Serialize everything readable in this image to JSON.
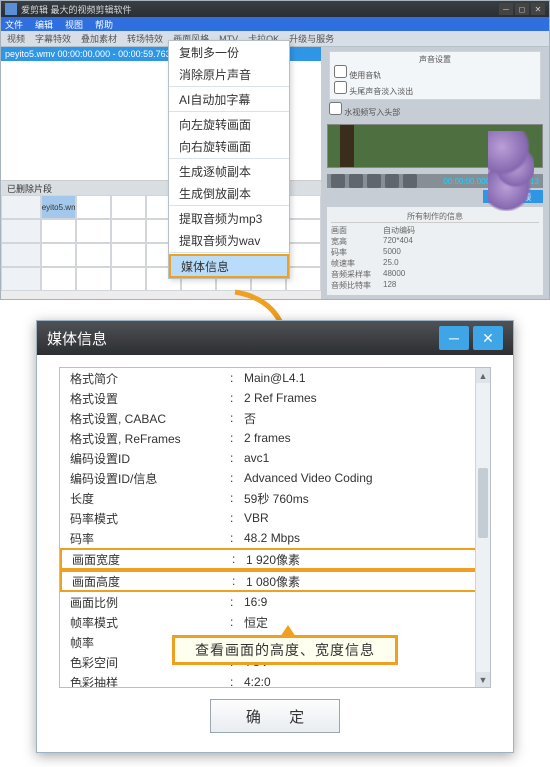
{
  "app": {
    "title": "爱剪辑 最大的视频剪辑软件",
    "menus": [
      "文件",
      "编辑",
      "视图",
      "帮助"
    ],
    "tabs": [
      "视频",
      "字幕特效",
      "叠加素材",
      "转场特效",
      "画面风格",
      "MTV",
      "卡拉OK",
      "升级与服务"
    ],
    "source_row": "peyito5.wmv   00:00:00.000 - 00:00:59.763   00:00:59.763",
    "timeline_col0": "已删除片段",
    "clip_name": "peyito5.wmv"
  },
  "preview": {
    "timecode": "00:00:00.000  00:00:05.713",
    "export_label": "导出视频",
    "panel_title": "所有制作的信息",
    "panel_rows": [
      {
        "k": "画面",
        "v": "自动编码"
      },
      {
        "k": "宽高",
        "v": "720*404"
      },
      {
        "k": "码率",
        "v": "5000"
      },
      {
        "k": "帧速率",
        "v": "25.0"
      },
      {
        "k": "音频采样率",
        "v": "48000"
      },
      {
        "k": "音频比特率",
        "v": "128"
      }
    ],
    "opt1": "声音设置",
    "chk1": "使用音轨",
    "chk2": "头尾声音淡入淡出",
    "chk3": "水视频写入头部"
  },
  "context_menu": {
    "items": [
      "复制多一份",
      "消除原片声音",
      "-",
      "AI自动加字幕",
      "-",
      "向左旋转画面",
      "向右旋转画面",
      "-",
      "生成逐帧副本",
      "生成倒放副本",
      "-",
      "提取音频为mp3",
      "提取音频为wav",
      "-",
      "媒体信息"
    ],
    "selected": "媒体信息"
  },
  "dialog": {
    "title": "媒体信息",
    "rows": [
      {
        "k": "格式简介",
        "v": "Main@L4.1"
      },
      {
        "k": "格式设置",
        "v": "2 Ref Frames"
      },
      {
        "k": "格式设置, CABAC",
        "v": "否"
      },
      {
        "k": "格式设置, ReFrames",
        "v": "2 frames"
      },
      {
        "k": "编码设置ID",
        "v": "avc1"
      },
      {
        "k": "编码设置ID/信息",
        "v": "Advanced Video Coding"
      },
      {
        "k": "长度",
        "v": "59秒 760ms"
      },
      {
        "k": "码率模式",
        "v": "VBR"
      },
      {
        "k": "码率",
        "v": "48.2 Mbps"
      },
      {
        "k": "画面宽度",
        "v": "1 920像素",
        "hl": true
      },
      {
        "k": "画面高度",
        "v": "1 080像素",
        "hl": true
      },
      {
        "k": "画面比例",
        "v": "16:9"
      },
      {
        "k": "帧率模式",
        "v": "恒定"
      },
      {
        "k": "帧率",
        "v": ""
      },
      {
        "k": "色彩空间",
        "v": "YUV"
      },
      {
        "k": "色彩抽样",
        "v": "4:2:0"
      }
    ],
    "annotation": "查看画面的高度、宽度信息",
    "ok": "确 定"
  }
}
